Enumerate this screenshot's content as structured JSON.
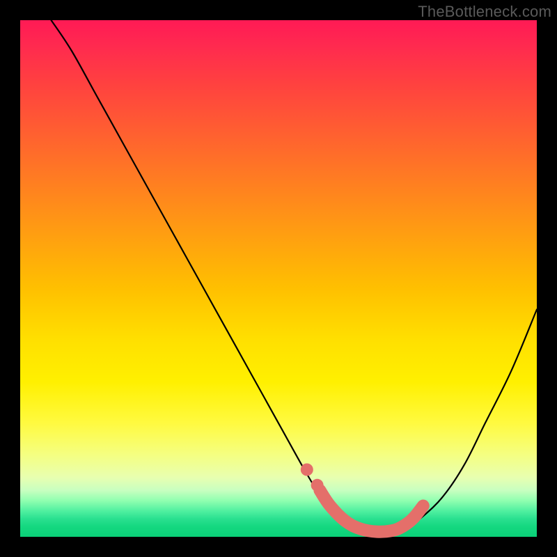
{
  "watermark": "TheBottleneck.com",
  "chart_data": {
    "type": "line",
    "title": "",
    "xlabel": "",
    "ylabel": "",
    "xlim": [
      0,
      100
    ],
    "ylim": [
      0,
      100
    ],
    "grid": false,
    "series": [
      {
        "name": "bottleneck-curve",
        "x": [
          6,
          10,
          15,
          20,
          25,
          30,
          35,
          40,
          45,
          50,
          55,
          58,
          60,
          62,
          65,
          68,
          70,
          72,
          75,
          78,
          82,
          86,
          90,
          95,
          100
        ],
        "y": [
          100,
          94,
          85,
          76,
          67,
          58,
          49,
          40,
          31,
          22,
          13,
          8,
          5,
          3,
          1.5,
          1,
          1,
          1.2,
          2,
          4,
          8,
          14,
          22,
          32,
          44
        ]
      }
    ],
    "highlight": {
      "name": "optimal-range",
      "x": [
        58,
        60,
        63,
        66,
        69,
        72,
        74,
        76,
        78
      ],
      "y": [
        9,
        6,
        3,
        1.5,
        1,
        1.2,
        2,
        3.5,
        6
      ]
    },
    "highlight_dots": [
      {
        "x": 55.5,
        "y": 13
      },
      {
        "x": 57.5,
        "y": 10
      }
    ],
    "background_gradient": {
      "top": "#ff1a55",
      "mid": "#ffe000",
      "bottom": "#0ad078"
    }
  }
}
